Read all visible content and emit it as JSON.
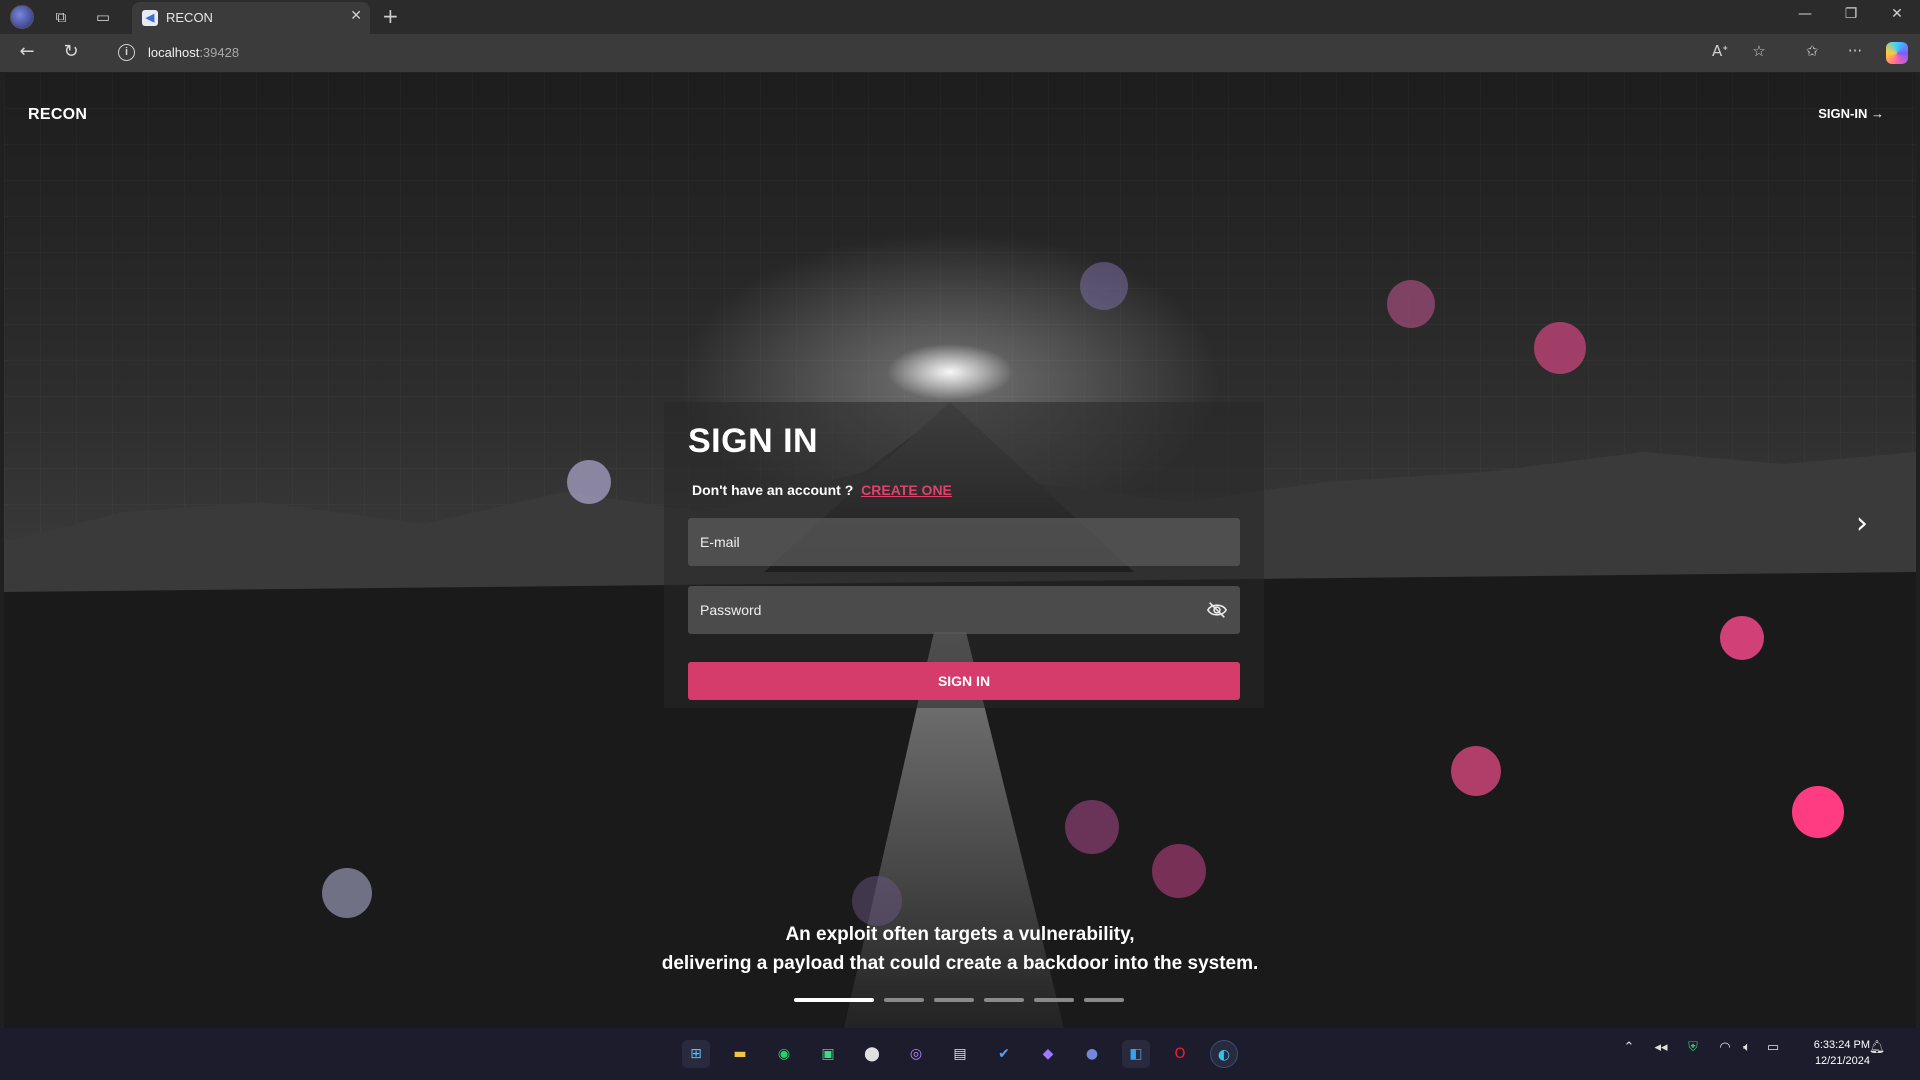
{
  "browser": {
    "tab_title": "RECON",
    "tab_close": "✕",
    "new_tab": "+",
    "url_host": "localhost",
    "url_port": ":39428",
    "window_controls": [
      "—",
      "❐",
      "✕"
    ]
  },
  "nav": {
    "brand": "RECON",
    "signin_link": "SIGN-IN →",
    "next_arrow": "›"
  },
  "form": {
    "title": "SIGN IN",
    "no_account_text": "Don't have an account ?",
    "create_link": "CREATE ONE",
    "email_placeholder": "E-mail",
    "password_placeholder": "Password",
    "submit_label": "SIGN IN"
  },
  "carousel": {
    "caption_line1": "An exploit often targets a vulnerability,",
    "caption_line2": "delivering a payload that could create a backdoor into the system.",
    "slide_count": 6,
    "active_slide": 1
  },
  "taskbar": {
    "icons": [
      "windows-icon",
      "file-explorer-icon",
      "whatsapp-icon",
      "app-icon",
      "maps-icon",
      "github-icon",
      "terminal-icon",
      "todo-icon",
      "obsidian-icon",
      "discord-icon",
      "vscode-icon",
      "opera-icon",
      "edge-icon"
    ],
    "time": "6:33:24 PM",
    "date": "12/21/2024"
  },
  "colors": {
    "accent": "#d63c6b",
    "link": "#e0426e"
  }
}
